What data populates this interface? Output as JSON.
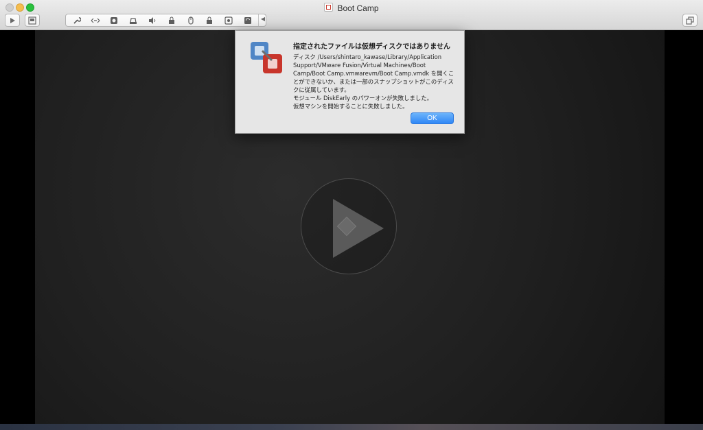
{
  "window": {
    "title": "Boot Camp"
  },
  "toolbar": {
    "play_icon": "play-icon",
    "snapshot_icon": "snapshot-icon",
    "group_icons": [
      "wrench-icon",
      "network-icon",
      "disk-icon",
      "printer-icon",
      "speaker-icon",
      "usb-lock-icon",
      "mouse-lock-icon",
      "usb-lock-icon",
      "camera-icon",
      "refresh-icon"
    ],
    "fullscreen_icon": "window-icon"
  },
  "alert": {
    "title": "指定されたファイルは仮想ディスクではありません",
    "body_lines": [
      "ディスク /Users/shintaro_kawase/Library/Application Support/VMware Fusion/Virtual Machines/Boot Camp/Boot Camp.vmwarevm/Boot Camp.vmdk を開くことができないか、または一部のスナップショットがこのディスクに従属しています。",
      "モジュール DiskEarly のパワーオンが失敗しました。",
      "仮想マシンを開始することに失敗しました。"
    ],
    "ok_label": "OK"
  },
  "colors": {
    "accent": "#2f86f6",
    "close": "#cfcfcf",
    "minimize": "#f5bd4f",
    "maximize": "#29c13d"
  }
}
